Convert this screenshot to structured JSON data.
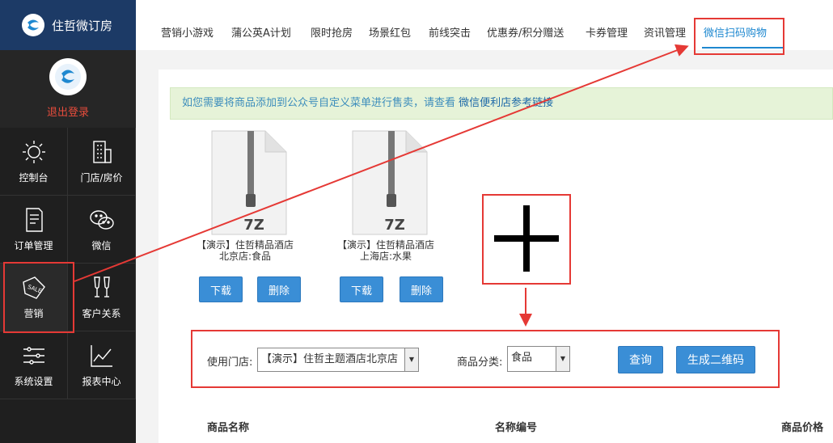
{
  "brand": {
    "name": "住哲微订房"
  },
  "profile": {
    "logout_label": "退出登录"
  },
  "sidebar": {
    "items": [
      {
        "label": "控制台",
        "icon": "sun-icon"
      },
      {
        "label": "门店/房价",
        "icon": "building-icon"
      },
      {
        "label": "订单管理",
        "icon": "document-icon"
      },
      {
        "label": "微信",
        "icon": "wechat-icon"
      },
      {
        "label": "营销",
        "icon": "sale-tag-icon"
      },
      {
        "label": "客户关系",
        "icon": "glasses-icon"
      },
      {
        "label": "系统设置",
        "icon": "sliders-icon"
      },
      {
        "label": "报表中心",
        "icon": "line-chart-icon"
      }
    ]
  },
  "topnav": {
    "tabs": [
      "营销小游戏",
      "蒲公英A计划",
      "限时抢房",
      "场景红包",
      "前线突击",
      "优惠券/积分赠送",
      "卡券管理",
      "资讯管理",
      "微信扫码购物"
    ],
    "active": "微信扫码购物"
  },
  "notice": {
    "text": "如您需要将商品添加到公众号自定义菜单进行售卖，请查看 ",
    "link": "微信便利店参考链接"
  },
  "files": [
    {
      "ext": "7Z",
      "name": "【演示】住哲精品酒店北京店:食品",
      "download": "下载",
      "delete": "删除"
    },
    {
      "ext": "7Z",
      "name": "【演示】住哲精品酒店上海店:水果",
      "download": "下载",
      "delete": "删除"
    }
  ],
  "filters": {
    "store_label": "使用门店:",
    "store_value": "【演示】住哲主题酒店北京店",
    "category_label": "商品分类:",
    "category_value": "食品",
    "query_button": "查询",
    "qrcode_button": "生成二维码"
  },
  "table": {
    "headers": [
      "商品名称",
      "名称编号",
      "商品价格"
    ]
  },
  "colors": {
    "brand": "#1c3a66",
    "accent": "#1e88d0",
    "annotation": "#e53935"
  }
}
